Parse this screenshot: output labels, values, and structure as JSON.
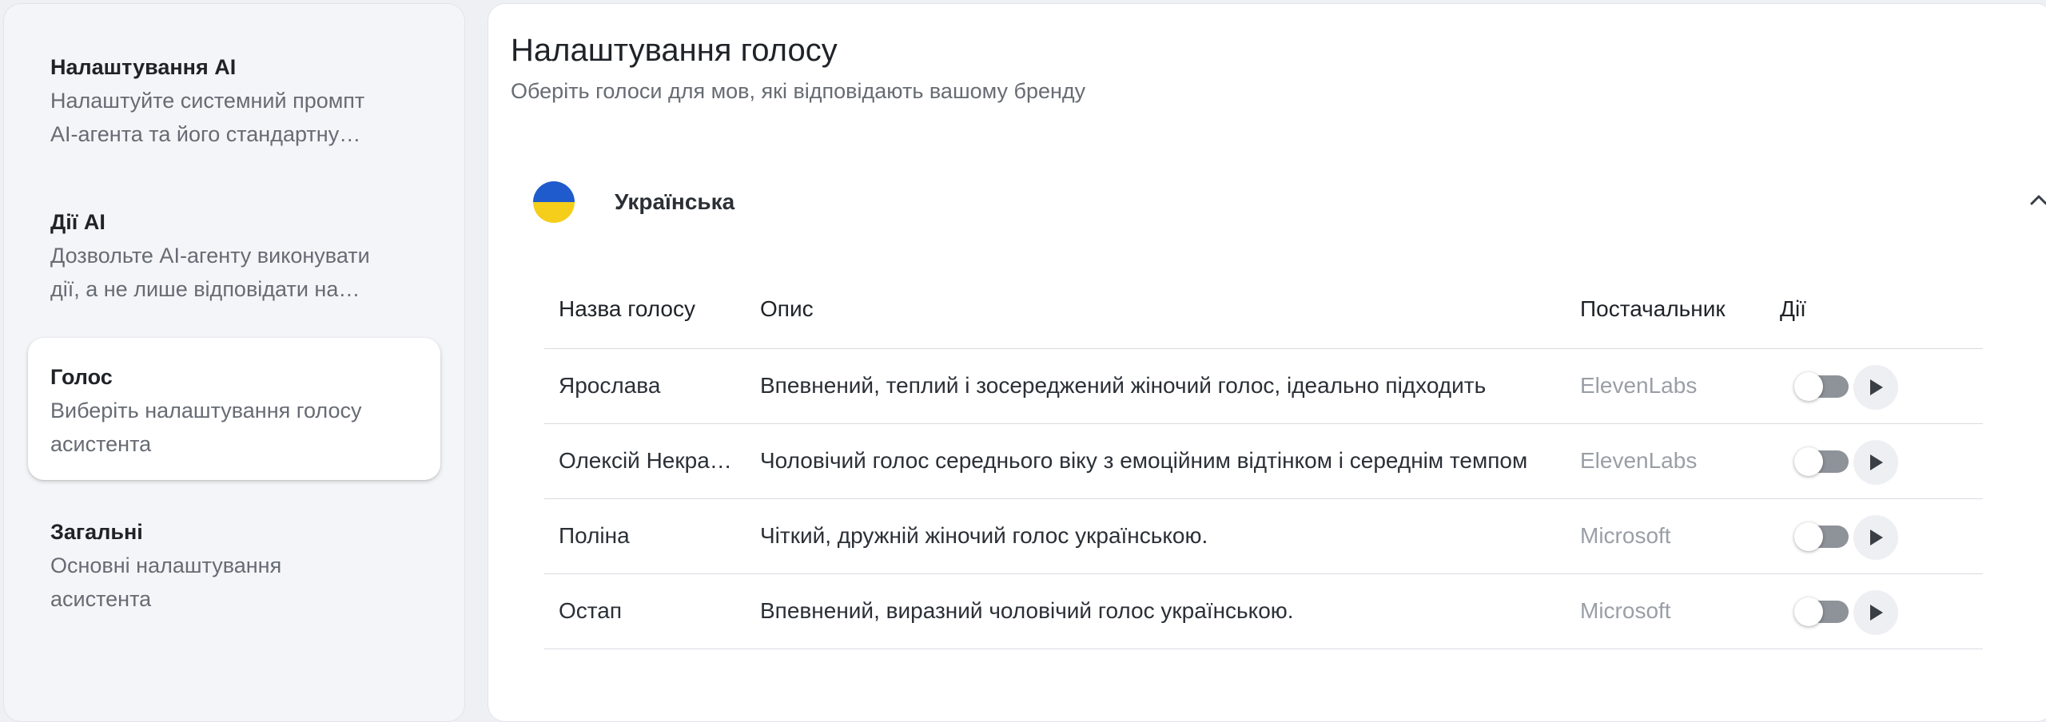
{
  "sidebar": {
    "items": [
      {
        "title": "Налаштування AI",
        "desc_line1": "Налаштуйте системний промпт",
        "desc_line2": "AI-агента та його стандартну…"
      },
      {
        "title": "Дії AI",
        "desc_line1": "Дозвольте AI-агенту виконувати",
        "desc_line2": "дії, а не лише відповідати на…"
      },
      {
        "title": "Голос",
        "desc_line1": "Виберіть налаштування голосу",
        "desc_line2": "асистента"
      },
      {
        "title": "Загальні",
        "desc_line1": "Основні налаштування",
        "desc_line2": "асистента"
      }
    ],
    "active_index": 2
  },
  "main": {
    "title": "Налаштування голосу",
    "subtitle": "Оберіть голоси для мов, які відповідають вашому бренду",
    "language": {
      "name": "Українська",
      "flag_icon": "ukraine-flag-icon",
      "flag_colors": [
        "#1f5bcc",
        "#f5cd1b"
      ],
      "expanded": true
    },
    "table": {
      "headers": {
        "name": "Назва голосу",
        "desc": "Опис",
        "provider": "Постачальник",
        "actions": "Дії"
      },
      "rows": [
        {
          "name": "Ярослава",
          "desc": "Впевнений, теплий і зосереджений жіночий голос, ідеально підходить",
          "provider": "ElevenLabs",
          "enabled": false
        },
        {
          "name": "Олексій Некрасов",
          "desc": "Чоловічий голос середнього віку з емоційним відтінком і середнім темпом",
          "provider": "ElevenLabs",
          "enabled": false
        },
        {
          "name": "Поліна",
          "desc": "Чіткий, дружній жіночий голос українською.",
          "provider": "Microsoft",
          "enabled": false
        },
        {
          "name": "Остап",
          "desc": "Впевнений, виразний чоловічий голос українською.",
          "provider": "Microsoft",
          "enabled": false
        }
      ]
    }
  }
}
